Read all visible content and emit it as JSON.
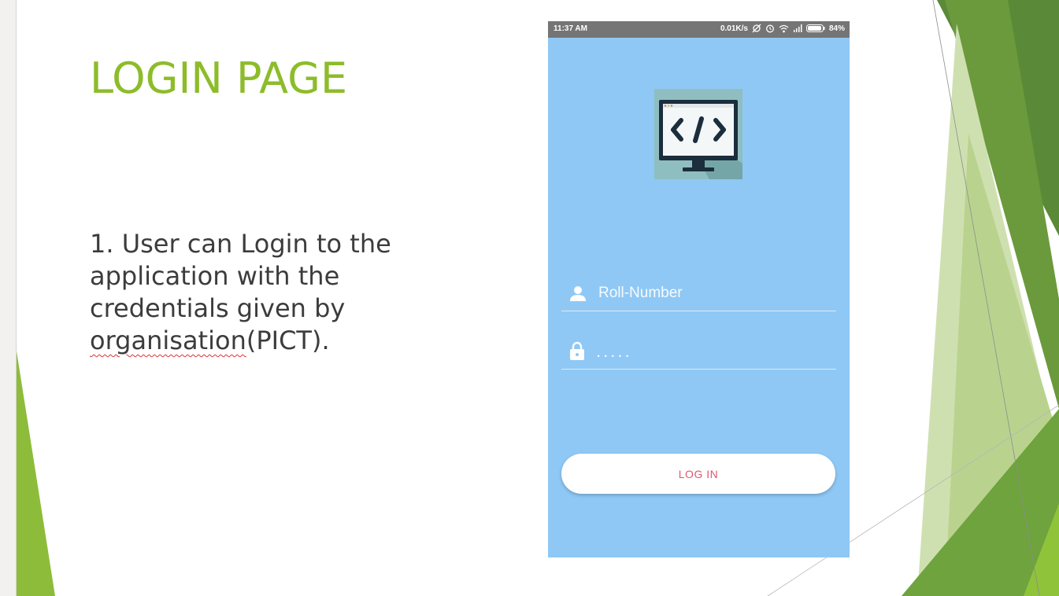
{
  "slide": {
    "title": "LOGIN PAGE",
    "bullet_prefix": "1.  User can Login to the application with the credentials given by ",
    "bullet_misspelled": "organisation",
    "bullet_suffix": "(PICT).",
    "accent_color": "#8dbc2a"
  },
  "phone": {
    "status_bar": {
      "time": "11:37 AM",
      "net_speed": "0.01K/s",
      "battery": "84%",
      "icons": [
        "sync-off-icon",
        "alarm-icon",
        "wifi-icon",
        "signal-icon",
        "battery-icon"
      ]
    },
    "logo_icon": "code-monitor-icon",
    "form": {
      "username_placeholder": "Roll-Number",
      "username_icon": "person-icon",
      "password_value": ".....",
      "password_icon": "lock-icon",
      "login_label": "LOG IN"
    },
    "colors": {
      "background": "#8fc8f5",
      "status_bar": "#757575",
      "button_text": "#e2566b"
    }
  }
}
